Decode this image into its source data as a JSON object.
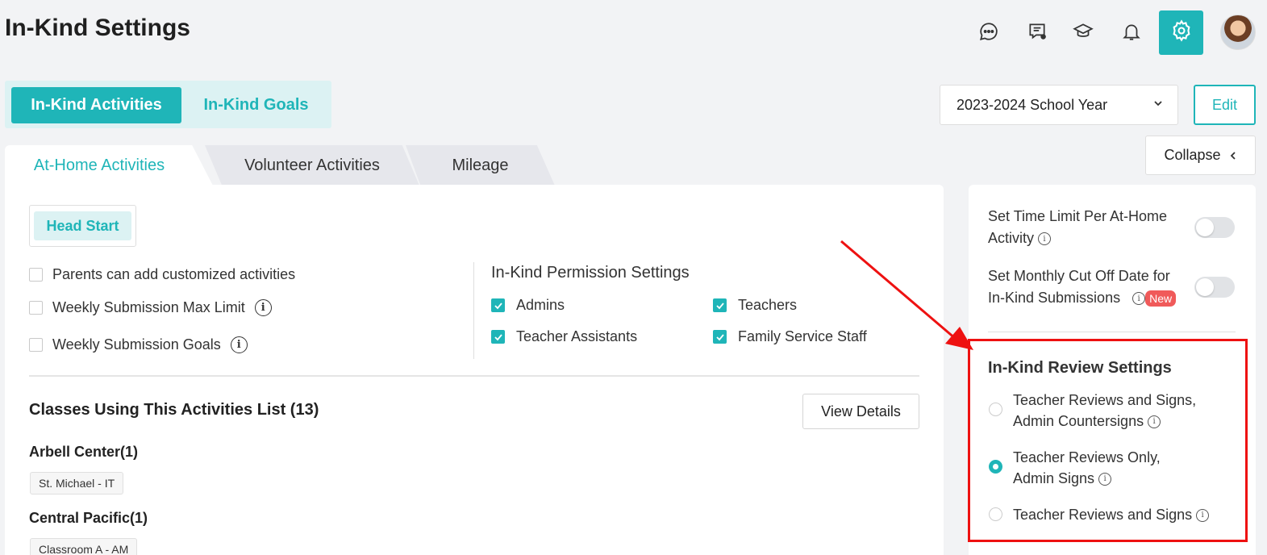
{
  "header": {
    "title": "In-Kind Settings",
    "icons": [
      "chat-icon",
      "message-board-icon",
      "graduation-cap-icon",
      "bell-icon",
      "gear-icon",
      "avatar"
    ]
  },
  "top_tabs": {
    "active": "In-Kind Activities",
    "inactive": "In-Kind Goals"
  },
  "year_select": {
    "value": "2023-2024 School Year"
  },
  "edit_label": "Edit",
  "collapse_label": "Collapse",
  "sub_tabs": [
    "At-Home Activities",
    "Volunteer Activities",
    "Mileage"
  ],
  "program": "Head Start",
  "options": [
    {
      "label": "Parents can add customized activities",
      "checked": false
    },
    {
      "label": "Weekly Submission Max Limit",
      "checked": false
    },
    {
      "label": "Weekly Submission Goals",
      "checked": false
    }
  ],
  "permissions": {
    "title": "In-Kind Permission Settings",
    "items": [
      {
        "label": "Admins",
        "checked": true
      },
      {
        "label": "Teachers",
        "checked": true
      },
      {
        "label": "Teacher Assistants",
        "checked": true
      },
      {
        "label": "Family Service Staff",
        "checked": true
      }
    ]
  },
  "classes": {
    "title": "Classes Using This Activities List (13)",
    "view_details": "View Details",
    "centers": [
      {
        "name": "Arbell Center(1)",
        "class": "St. Michael - IT"
      },
      {
        "name": "Central Pacific(1)",
        "class": "Classroom A - AM"
      }
    ]
  },
  "side_panel": {
    "time_limit": {
      "line1": "Set Time Limit Per At-Home",
      "line2": "Activity",
      "enabled": false
    },
    "cutoff": {
      "line1": "Set Monthly Cut Off Date for",
      "line2": "In-Kind Submissions",
      "badge": "New",
      "enabled": false
    },
    "review_title": "In-Kind Review Settings",
    "review_options": [
      {
        "line1": "Teacher Reviews and Signs,",
        "line2": "Admin Countersigns",
        "selected": false
      },
      {
        "line1": "Teacher Reviews Only,",
        "line2": "Admin Signs",
        "selected": true
      },
      {
        "line1": "Teacher Reviews and Signs",
        "line2": "",
        "selected": false
      }
    ]
  },
  "colors": {
    "accent": "#1fb5b8",
    "annotation": "#ee1111",
    "badge": "#f05a5a"
  }
}
